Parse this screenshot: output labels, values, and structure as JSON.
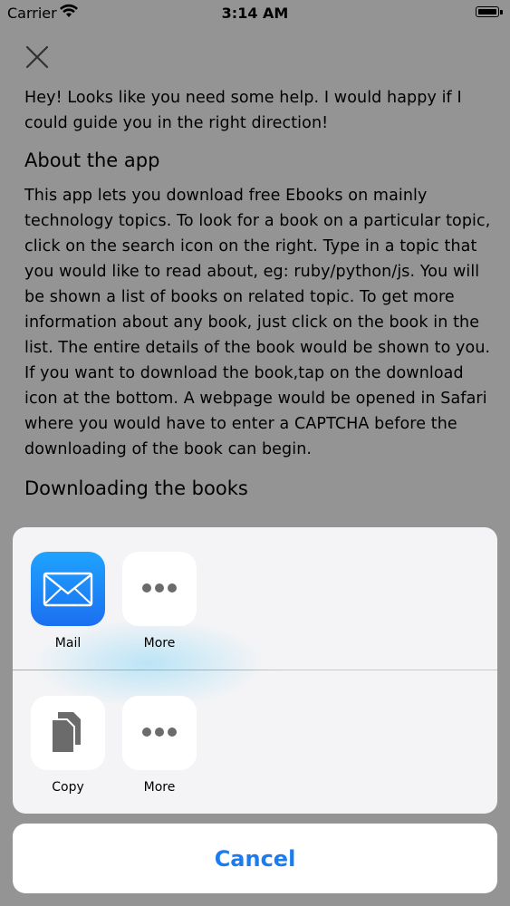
{
  "status_bar": {
    "carrier": "Carrier",
    "time": "3:14 AM"
  },
  "help": {
    "intro": "Hey! Looks like you need some help. I would happy if I could guide you in the right direction!",
    "about_heading": "About the app",
    "about_body": "This app lets you download free Ebooks on mainly technology topics. To look for a book on a particular topic, click on the search icon on the right. Type in a topic that you would like to read about, eg: ruby/python/js. You will be shown a list of books on related topic. To get more information about any book, just click on the book in the list. The entire details of the book would be shown to you. If you want to download the book,tap on the download icon at the bottom. A webpage would be opened in Safari where you would have to enter a CAPTCHA before the downloading of the book can begin.",
    "download_heading": "Downloading the books"
  },
  "share_sheet": {
    "share_row": [
      {
        "label": "Mail",
        "icon": "mail-icon"
      },
      {
        "label": "More",
        "icon": "more-icon"
      }
    ],
    "action_row": [
      {
        "label": "Copy",
        "icon": "copy-icon"
      },
      {
        "label": "More",
        "icon": "more-icon"
      }
    ],
    "cancel_label": "Cancel"
  },
  "colors": {
    "accent": "#1b7cf2",
    "mail_gradient_top": "#1fa3ff",
    "mail_gradient_bottom": "#1b6ff0"
  }
}
